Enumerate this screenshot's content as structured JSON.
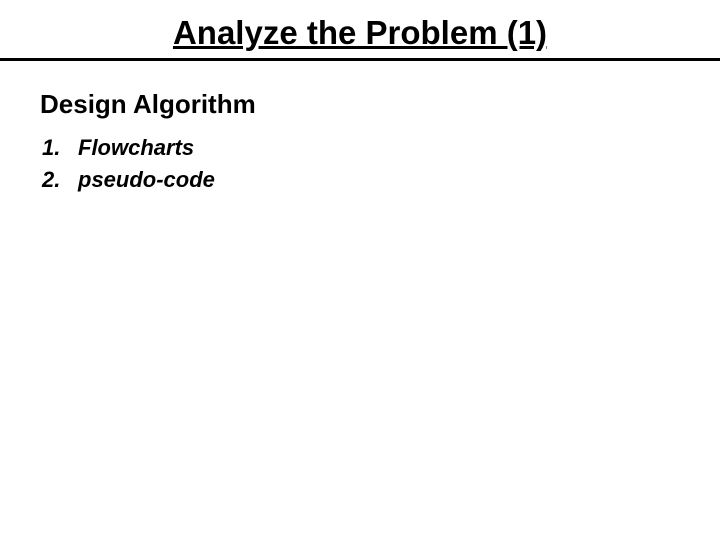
{
  "slide": {
    "title": "Analyze the Problem (1)",
    "section_heading": "Design Algorithm",
    "items": [
      {
        "num": "1.",
        "text": "Flowcharts"
      },
      {
        "num": "2.",
        "text": "pseudo-code"
      }
    ]
  }
}
